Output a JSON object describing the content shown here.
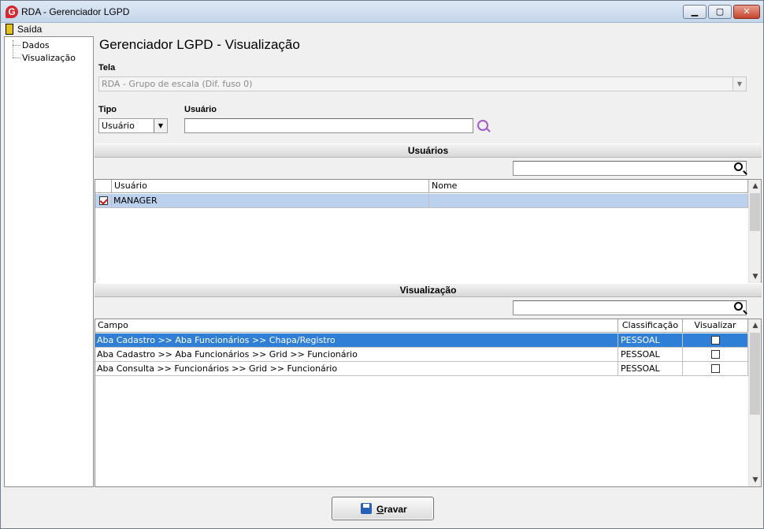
{
  "window": {
    "title": "RDA - Gerenciador LGPD",
    "minimize": "▁",
    "maximize": "▢",
    "close": "✕"
  },
  "menu": {
    "exit_label": "Saída"
  },
  "tree": {
    "items": [
      "Dados",
      "Visualização"
    ]
  },
  "main": {
    "title": "Gerenciador LGPD - Visualização",
    "screen_label": "Tela",
    "screen_value": "RDA - Grupo de escala (Dif. fuso 0)",
    "type_label": "Tipo",
    "type_value": "Usuário",
    "user_label": "Usuário",
    "user_value": ""
  },
  "users_section": {
    "title": "Usuários",
    "filter_value": "",
    "columns": [
      "Usuário",
      "Nome"
    ],
    "rows": [
      {
        "checked": true,
        "user": "MANAGER",
        "name": ""
      }
    ]
  },
  "view_section": {
    "title": "Visualização",
    "filter_value": "",
    "columns": [
      "Campo",
      "Classificação",
      "Visualizar"
    ],
    "rows": [
      {
        "field": "Aba Cadastro >> Aba Funcionários >> Chapa/Registro",
        "classification": "PESSOAL",
        "visible": false
      },
      {
        "field": "Aba Cadastro >> Aba Funcionários >> Grid >> Funcionário",
        "classification": "PESSOAL",
        "visible": false
      },
      {
        "field": "Aba Consulta >> Funcionários >> Grid >> Funcionário",
        "classification": "PESSOAL",
        "visible": false
      }
    ]
  },
  "footer": {
    "save_label_first": "G",
    "save_label_rest": "ravar"
  },
  "colors": {
    "selection_blue": "#2f7fd6",
    "selection_light": "#bcd1ee",
    "accent_purple": "#a05cc8"
  }
}
